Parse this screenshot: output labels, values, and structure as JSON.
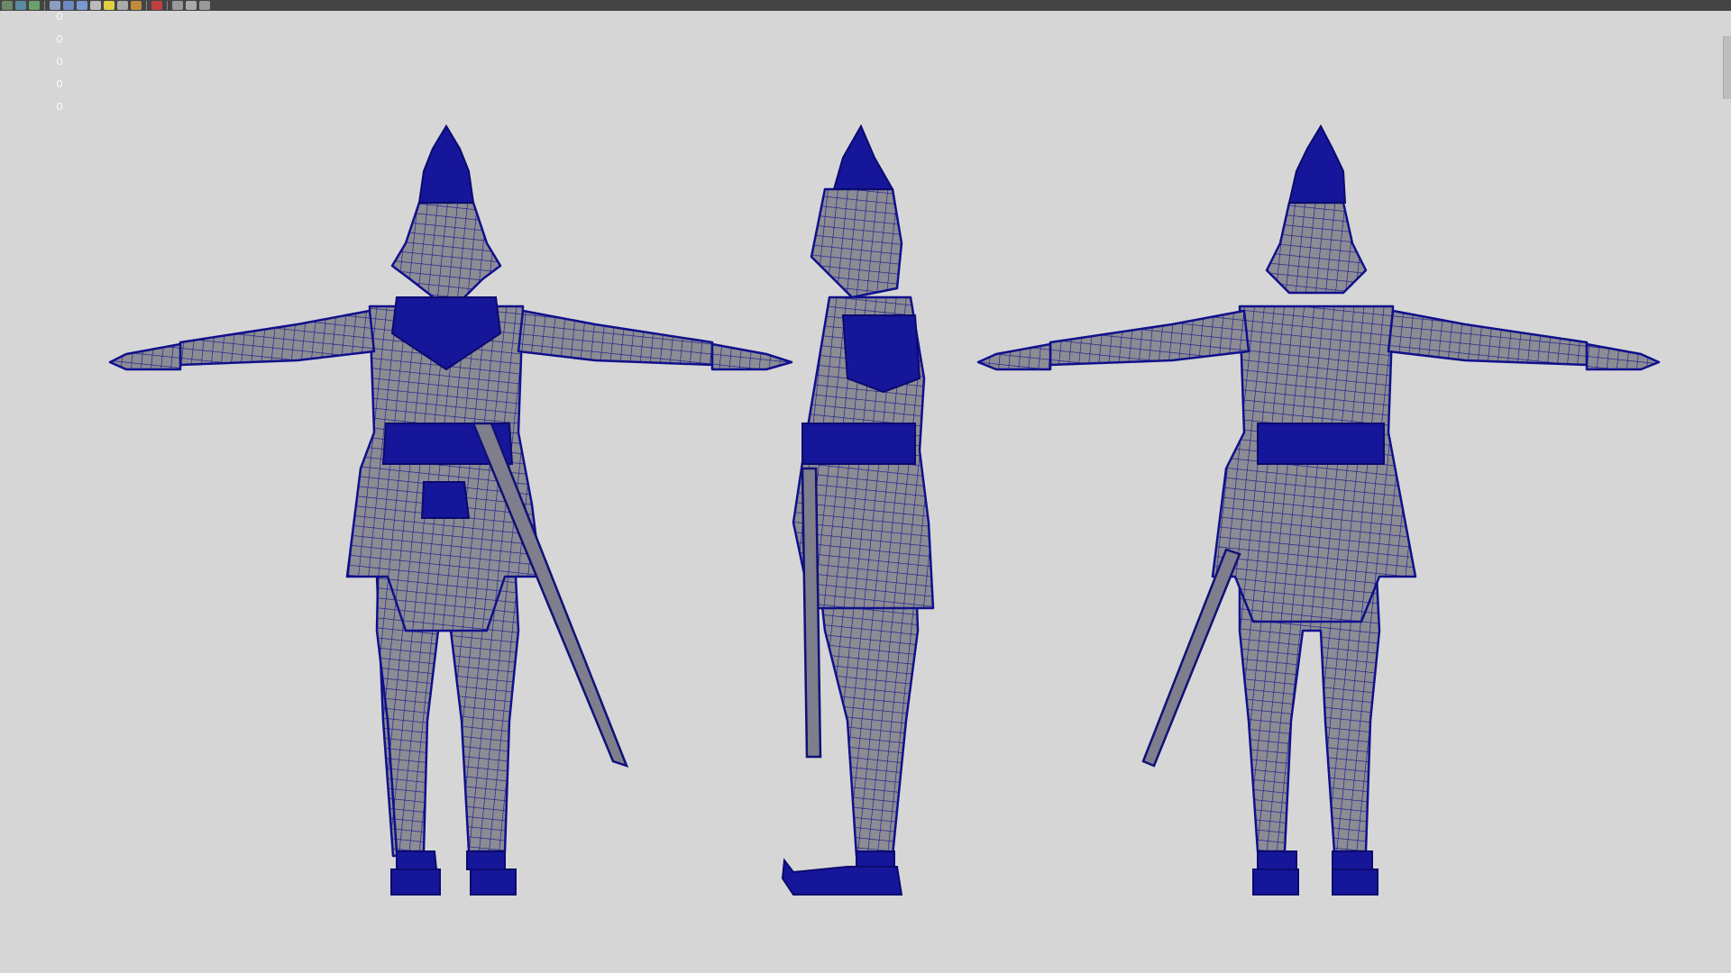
{
  "toolbar": {
    "icons": [
      "select-icon",
      "lasso-icon",
      "paint-icon",
      "cube-icon",
      "shaded-cube-icon",
      "textured-cube-icon",
      "checker-icon",
      "light-bulb-icon",
      "sphere-icon",
      "material-icon",
      "xray-icon",
      "isolate-icon",
      "camera-icon",
      "render-icon"
    ]
  },
  "viewport": {
    "background": "#d6d6d6",
    "wire_color": "#10108c",
    "shaded_color": "#8c8c94",
    "views": [
      "front",
      "side",
      "back"
    ]
  }
}
